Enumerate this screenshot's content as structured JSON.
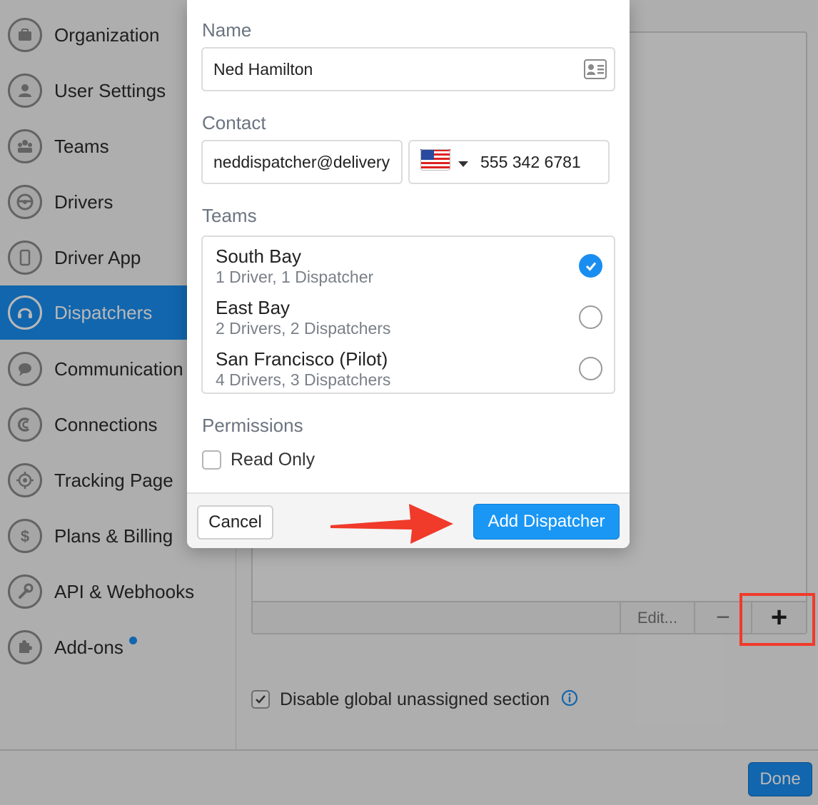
{
  "sidebar": {
    "items": [
      {
        "label": "Organization",
        "icon": "briefcase-icon"
      },
      {
        "label": "User Settings",
        "icon": "user-icon"
      },
      {
        "label": "Teams",
        "icon": "team-icon"
      },
      {
        "label": "Drivers",
        "icon": "steering-wheel-icon"
      },
      {
        "label": "Driver App",
        "icon": "phone-icon"
      },
      {
        "label": "Dispatchers",
        "icon": "headset-icon",
        "active": true
      },
      {
        "label": "Communication",
        "icon": "chat-bubble-icon"
      },
      {
        "label": "Connections",
        "icon": "connection-icon"
      },
      {
        "label": "Tracking Page",
        "icon": "target-icon"
      },
      {
        "label": "Plans & Billing",
        "icon": "dollar-icon"
      },
      {
        "label": "API & Webhooks",
        "icon": "wrench-icon"
      },
      {
        "label": "Add-ons",
        "icon": "puzzle-icon",
        "badge": true
      }
    ]
  },
  "modal": {
    "name_label": "Name",
    "name_value": "Ned Hamilton",
    "contact_label": "Contact",
    "email_value": "neddispatcher@delivery",
    "phone_value": "555 342 6781",
    "country": "US",
    "teams_label": "Teams",
    "teams": [
      {
        "name": "South Bay",
        "detail": "1 Driver, 1 Dispatcher",
        "checked": true
      },
      {
        "name": "East Bay",
        "detail": "2 Drivers, 2 Dispatchers",
        "checked": false
      },
      {
        "name": "San Francisco (Pilot)",
        "detail": "4 Drivers, 3 Dispatchers",
        "checked": false
      }
    ],
    "permissions_label": "Permissions",
    "read_only_label": "Read Only",
    "cancel_label": "Cancel",
    "add_label": "Add Dispatcher"
  },
  "panel": {
    "edit_label": "Edit...",
    "minus_label": "−",
    "plus_label": "+"
  },
  "options": {
    "disable_global_label": "Disable global unassigned section"
  },
  "footer": {
    "done_label": "Done"
  },
  "colors": {
    "accent": "#1a8ef0",
    "annotation": "#f03a2a"
  }
}
